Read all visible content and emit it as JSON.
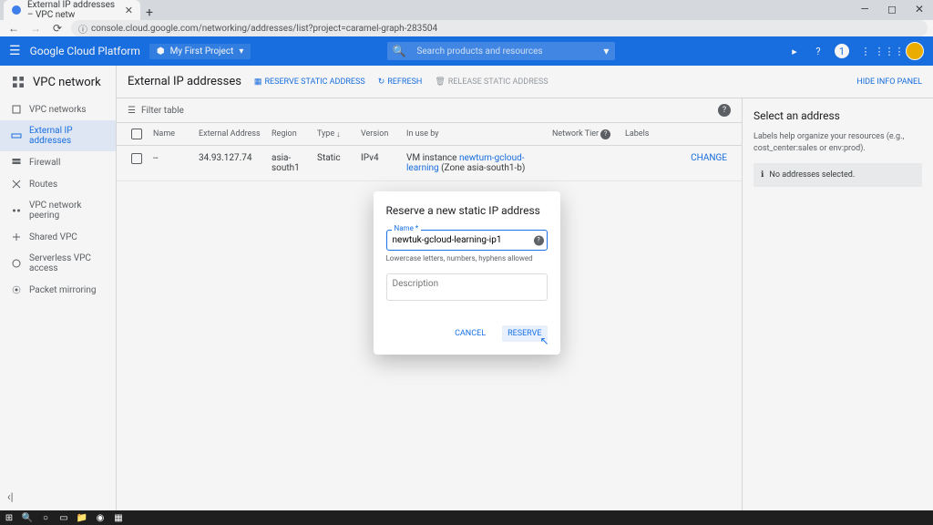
{
  "browser": {
    "tab_title": "External IP addresses – VPC netw",
    "url": "console.cloud.google.com/networking/addresses/list?project=caramel-graph-283504"
  },
  "gcp_header": {
    "product": "Google Cloud Platform",
    "project": "My First Project",
    "search_placeholder": "Search products and resources",
    "trial_badge": "1"
  },
  "sidebar": {
    "title": "VPC network",
    "items": [
      {
        "label": "VPC networks"
      },
      {
        "label": "External IP addresses"
      },
      {
        "label": "Firewall"
      },
      {
        "label": "Routes"
      },
      {
        "label": "VPC network peering"
      },
      {
        "label": "Shared VPC"
      },
      {
        "label": "Serverless VPC access"
      },
      {
        "label": "Packet mirroring"
      }
    ]
  },
  "content": {
    "title": "External IP addresses",
    "actions": {
      "reserve": "RESERVE STATIC ADDRESS",
      "refresh": "REFRESH",
      "release": "RELEASE STATIC ADDRESS",
      "hide_panel": "HIDE INFO PANEL"
    },
    "filter_placeholder": "Filter table",
    "columns": {
      "name": "Name",
      "ext_addr": "External Address",
      "region": "Region",
      "type": "Type",
      "version": "Version",
      "in_use": "In use by",
      "tier": "Network Tier",
      "labels": "Labels"
    },
    "rows": [
      {
        "name": "--",
        "ext_addr": "34.93.127.74",
        "region": "asia-south1",
        "type": "Static",
        "version": "IPv4",
        "in_use_prefix": "VM instance ",
        "in_use_link": "newtum-gcloud-learning",
        "in_use_suffix": " (Zone asia-south1-b)",
        "change": "CHANGE"
      }
    ]
  },
  "info_panel": {
    "title": "Select an address",
    "help": "Labels help organize your resources (e.g., cost_center:sales or env:prod).",
    "empty": "No addresses selected."
  },
  "modal": {
    "title": "Reserve a new static IP address",
    "name_label": "Name *",
    "name_value": "newtuk-gcloud-learning-ip1",
    "name_helper": "Lowercase letters, numbers, hyphens allowed",
    "desc_placeholder": "Description",
    "cancel": "CANCEL",
    "reserve": "RESERVE"
  }
}
